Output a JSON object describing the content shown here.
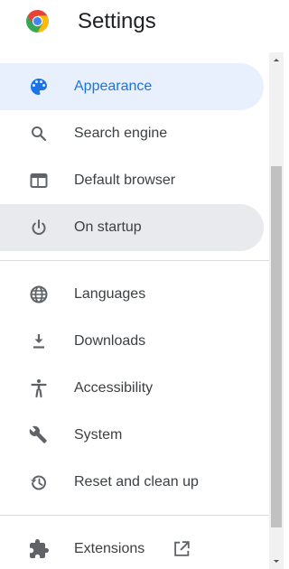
{
  "header": {
    "title": "Settings",
    "logo_icon": "chrome-logo"
  },
  "colors": {
    "accent": "#1a73e8",
    "selected_bg": "#e8f0fe",
    "hover_bg": "#e8eaed",
    "text": "#3c4043",
    "icon": "#5f6368"
  },
  "sidebar": {
    "items": [
      {
        "label": "Appearance",
        "icon": "palette-icon",
        "state": "selected"
      },
      {
        "label": "Search engine",
        "icon": "search-icon"
      },
      {
        "label": "Default browser",
        "icon": "browser-window-icon"
      },
      {
        "label": "On startup",
        "icon": "power-icon",
        "state": "hovered"
      },
      {
        "label": "Languages",
        "icon": "globe-icon"
      },
      {
        "label": "Downloads",
        "icon": "download-icon"
      },
      {
        "label": "Accessibility",
        "icon": "accessibility-icon"
      },
      {
        "label": "System",
        "icon": "wrench-icon"
      },
      {
        "label": "Reset and clean up",
        "icon": "restore-history-icon"
      },
      {
        "label": "Extensions",
        "icon": "puzzle-icon",
        "trailing_icon": "open-in-new-icon"
      }
    ]
  }
}
